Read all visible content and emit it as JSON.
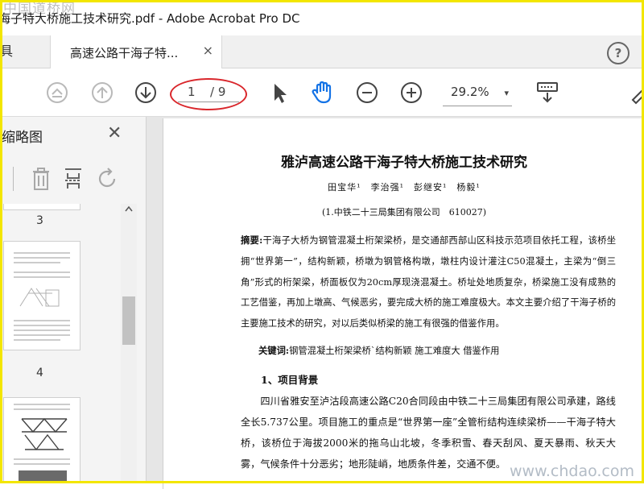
{
  "window": {
    "title": "海子特大桥施工技术研究.pdf - Adobe Acrobat Pro DC",
    "watermark_top": "中国道桥网"
  },
  "tabs": {
    "tools_label": "具",
    "doc_label": "高速公路干海子特...",
    "close_glyph": "×",
    "help_glyph": "?"
  },
  "toolbar": {
    "page_current": "1",
    "page_total": "/ 9",
    "zoom_value": "29.2%",
    "zoom_caret": "▾"
  },
  "left_panel": {
    "title": "缩略图",
    "close_glyph": "✕",
    "thumb_labels": [
      "3",
      "4"
    ]
  },
  "document": {
    "title": "雅泸高速公路干海子特大桥施工技术研究",
    "authors": "田宝华¹　李治强¹　彭继安¹　杨毅¹",
    "affiliation": "(1.中铁二十三局集团有限公司　610027)",
    "abstract_label": "摘要:",
    "abstract_text": "干海子大桥为钢管混凝土桁架梁桥，是交通部西部山区科技示范项目依托工程，该桥坐拥“世界第一”，结构新颖，桥墩为钢管格构墩，墩柱内设计灌注C50混凝土，主梁为“倒三角”形式的桁架梁，桥面板仅为20cm厚现浇混凝土。桥址处地质复杂，桥梁施工没有成熟的工艺借鉴，再加上墩高、气候恶劣，要完成大桥的施工难度极大。本文主要介绍了干海子桥的主要施工技术的研究，对以后类似桥梁的施工有很强的借鉴作用。",
    "keywords_label": "关键词:",
    "keywords_text": "钢管混凝土桁架梁桥`结构新颖 施工难度大 借鉴作用",
    "section_heading": "1、项目背景",
    "body_text": "四川省雅安至泸沽段高速公路C20合同段由中铁二十三局集团有限公司承建，路线全长5.737公里。项目施工的重点是“世界第一座”全管桁结构连续梁桥——干海子特大桥，该桥位于海拔2000米的拖乌山北坡，冬季积雪、春天刮风、夏天暴雨、秋天大雾，气候条件十分恶劣；地形陡峭，地质条件差，交通不便。",
    "watermark_bottom": "www.chdao.com"
  },
  "colors": {
    "accent_blue": "#1473e6",
    "annotation_red": "#d9262b",
    "frame_yellow": "#f3e600"
  }
}
